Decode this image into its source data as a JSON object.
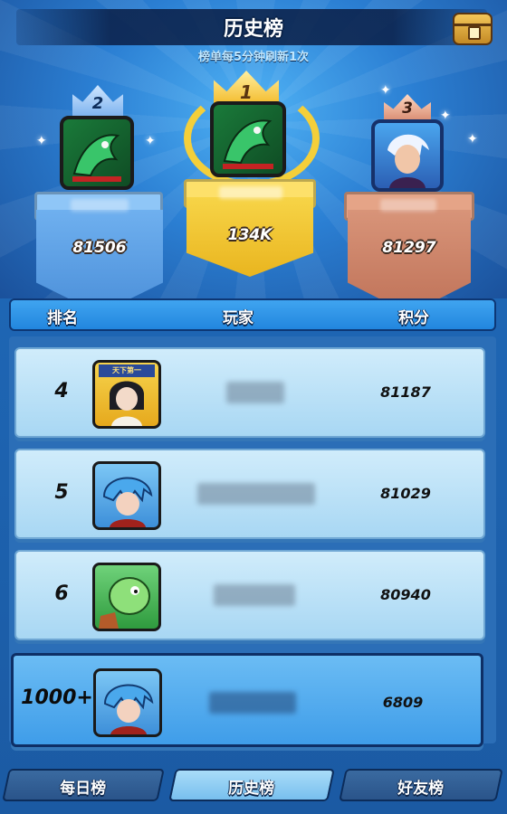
{
  "header": {
    "title": "历史榜",
    "subtitle": "榜单每5分钟刷新1次",
    "chest_icon": "treasure-chest-icon"
  },
  "podium": [
    {
      "rank": "2",
      "score": "81506",
      "avatar": "green-dragon-portrait",
      "color": "#7bbaf3"
    },
    {
      "rank": "1",
      "score": "134K",
      "avatar": "green-dragon-portrait",
      "color": "#f6cf3f"
    },
    {
      "rank": "3",
      "score": "81297",
      "avatar": "white-hair-warrior-portrait",
      "color": "#d88c72"
    }
  ],
  "columns": {
    "rank": "排名",
    "player": "玩家",
    "score": "积分"
  },
  "rows": [
    {
      "rank": "4",
      "score": "81187",
      "avatar": "hero-card-portrait",
      "avatar_text": "天下第一"
    },
    {
      "rank": "5",
      "score": "81029",
      "avatar": "blue-hair-hero-portrait"
    },
    {
      "rank": "6",
      "score": "80940",
      "avatar": "green-monster-portrait"
    }
  ],
  "me": {
    "rank": "1000+",
    "score": "6809",
    "avatar": "blue-hair-hero-portrait"
  },
  "tabs": [
    {
      "label": "每日榜",
      "active": false
    },
    {
      "label": "历史榜",
      "active": true
    },
    {
      "label": "好友榜",
      "active": false
    }
  ]
}
